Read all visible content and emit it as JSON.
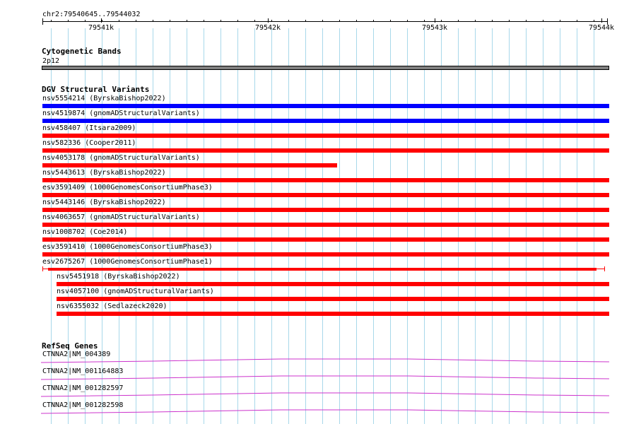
{
  "ruler": {
    "range": "chr2:79540645..79544032",
    "ticks": [
      "79541k",
      "79542k",
      "79543k",
      "79544k"
    ]
  },
  "cytoband": {
    "title": "Cytogenetic Bands",
    "band": "2p12",
    "color": "#808080"
  },
  "dgv": {
    "title": "DGV Structural Variants",
    "colors": {
      "gain": "#0000ff",
      "loss": "#ff0000"
    },
    "items": [
      {
        "label": "nsv5554214 (ByrskaBishop2022)",
        "type": "gain",
        "start": 79540645,
        "end": 79544032
      },
      {
        "label": "nsv4519874 (gnomADStructuralVariants)",
        "type": "gain",
        "start": 79540645,
        "end": 79544032
      },
      {
        "label": "nsv458407 (Itsara2009)",
        "type": "loss",
        "start": 79540645,
        "end": 79544032
      },
      {
        "label": "nsv582336 (Cooper2011)",
        "type": "loss",
        "start": 79540645,
        "end": 79544032
      },
      {
        "label": "nsv4053178 (gnomADStructuralVariants)",
        "type": "loss",
        "start": 79540645,
        "end": 79542400
      },
      {
        "label": "nsv5443613 (ByrskaBishop2022)",
        "type": "loss",
        "start": 79540645,
        "end": 79544032
      },
      {
        "label": "esv3591409 (1000GenomesConsortiumPhase3)",
        "type": "loss",
        "start": 79540645,
        "end": 79544032
      },
      {
        "label": "nsv5443146 (ByrskaBishop2022)",
        "type": "loss",
        "start": 79540645,
        "end": 79544032
      },
      {
        "label": "nsv4063657 (gnomADStructuralVariants)",
        "type": "loss",
        "start": 79540645,
        "end": 79544032
      },
      {
        "label": "nsv1008702 (Coe2014)",
        "type": "loss",
        "start": 79540645,
        "end": 79544032
      },
      {
        "label": "esv3591410 (1000GenomesConsortiumPhase3)",
        "type": "loss",
        "start": 79540645,
        "end": 79544032
      },
      {
        "label": "esv2675267 (1000GenomesConsortiumPhase1)",
        "type": "loss",
        "start": 79540645,
        "end": 79544032,
        "bracketed": true
      },
      {
        "label": "nsv5451918 (ByrskaBishop2022)",
        "type": "loss",
        "start": 79540730,
        "end": 79544032
      },
      {
        "label": "nsv4057100 (gnomADStructuralVariants)",
        "type": "loss",
        "start": 79540730,
        "end": 79544032
      },
      {
        "label": "nsv6355032 (Sedlazeck2020)",
        "type": "loss",
        "start": 79540730,
        "end": 79544032
      }
    ]
  },
  "refseq": {
    "title": "RefSeq Genes",
    "color": "#cc33cc",
    "items": [
      {
        "label": "CTNNA2|NM_004389"
      },
      {
        "label": "CTNNA2|NM_001164883"
      },
      {
        "label": "CTNNA2|NM_001282597"
      },
      {
        "label": "CTNNA2|NM_001282598"
      }
    ]
  }
}
